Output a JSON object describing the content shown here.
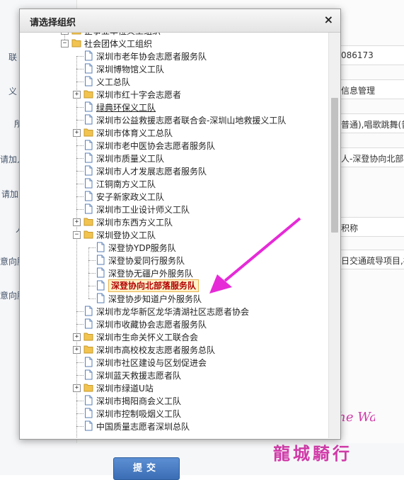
{
  "dialog": {
    "title": "请选择组织",
    "close_glyph": "×"
  },
  "tree": [
    {
      "label": "企事业单位义工组织",
      "type": "folder",
      "expanded": false,
      "level": 0
    },
    {
      "label": "社会团体义工组织",
      "type": "folder",
      "expanded": true,
      "level": 0
    },
    {
      "label": "深圳市老年协会志愿者服务队",
      "type": "leaf",
      "level": 1
    },
    {
      "label": "深圳博物馆义工队",
      "type": "leaf",
      "level": 1
    },
    {
      "label": "义工总队",
      "type": "leaf",
      "level": 1
    },
    {
      "label": "深圳市红十字会志愿者",
      "type": "folder",
      "expanded": false,
      "level": 1
    },
    {
      "label": "绿典环保义工队",
      "type": "leaf",
      "level": 1,
      "underline": true
    },
    {
      "label": "深圳市公益救援志愿者联合会-深圳山地救援义工队",
      "type": "leaf",
      "level": 1
    },
    {
      "label": "深圳市体育义工总队",
      "type": "folder",
      "expanded": false,
      "level": 1
    },
    {
      "label": "深圳市老中医协会志愿者服务队",
      "type": "leaf",
      "level": 1
    },
    {
      "label": "深圳市质量义工队",
      "type": "leaf",
      "level": 1
    },
    {
      "label": "深圳市人才发展志愿者服务队",
      "type": "leaf",
      "level": 1
    },
    {
      "label": "江铜南方义工队",
      "type": "leaf",
      "level": 1
    },
    {
      "label": "安子新家政义工队",
      "type": "leaf",
      "level": 1
    },
    {
      "label": "深圳市工业设计师义工队",
      "type": "leaf",
      "level": 1
    },
    {
      "label": "深圳市东西方义工队",
      "type": "folder",
      "expanded": false,
      "level": 1
    },
    {
      "label": "深圳登协义工队",
      "type": "folder",
      "expanded": true,
      "level": 1
    },
    {
      "label": "深登协YDP服务队",
      "type": "leaf",
      "level": 2
    },
    {
      "label": "深登协爱同行服务队",
      "type": "leaf",
      "level": 2
    },
    {
      "label": "深登协无疆户外服务队",
      "type": "leaf",
      "level": 2
    },
    {
      "label": "深登协向北部落服务队",
      "type": "leaf",
      "level": 2,
      "selected": true
    },
    {
      "label": "深登协步知道户外服务队",
      "type": "leaf",
      "level": 2
    },
    {
      "label": "深圳市龙华新区龙华清湖社区志愿者协会",
      "type": "leaf",
      "level": 1
    },
    {
      "label": "深圳市收藏协会志愿者服务队",
      "type": "leaf",
      "level": 1
    },
    {
      "label": "深圳市生命关怀义工联合会",
      "type": "folder",
      "expanded": false,
      "level": 1
    },
    {
      "label": "深圳市高校校友志愿者服务总队",
      "type": "folder",
      "expanded": false,
      "level": 1
    },
    {
      "label": "深圳市社区建设与区划促进会",
      "type": "leaf",
      "level": 1
    },
    {
      "label": "深圳蓝天救援志愿者队",
      "type": "leaf",
      "level": 1
    },
    {
      "label": "深圳市绿道U站",
      "type": "folder",
      "expanded": false,
      "level": 1
    },
    {
      "label": "深圳市揭阳商会义工队",
      "type": "leaf",
      "level": 1
    },
    {
      "label": "深圳市控制吸烟义工队",
      "type": "leaf",
      "level": 1
    },
    {
      "label": "中国质量志愿者深圳总队",
      "type": "leaf",
      "level": 1
    }
  ],
  "background_form": {
    "labels": [
      "ㅤ",
      "联",
      "义",
      "所",
      "请加人",
      "请加",
      "人",
      "意向服",
      "意向服"
    ],
    "values": [
      "086173",
      "信息管理",
      "普通),唱歌跳舞(普",
      "人-深登协向北部落",
      "积称",
      "日交通疏导项目,福"
    ],
    "submit_label": "提交"
  },
  "watermark": {
    "script_text": "On the Way",
    "chinese_text": "龍城騎行"
  },
  "colors": {
    "selected_text": "#b10000",
    "selected_bg": "#fff1c9",
    "folder": "#f2c44f",
    "arrow": "#e62ad7"
  }
}
